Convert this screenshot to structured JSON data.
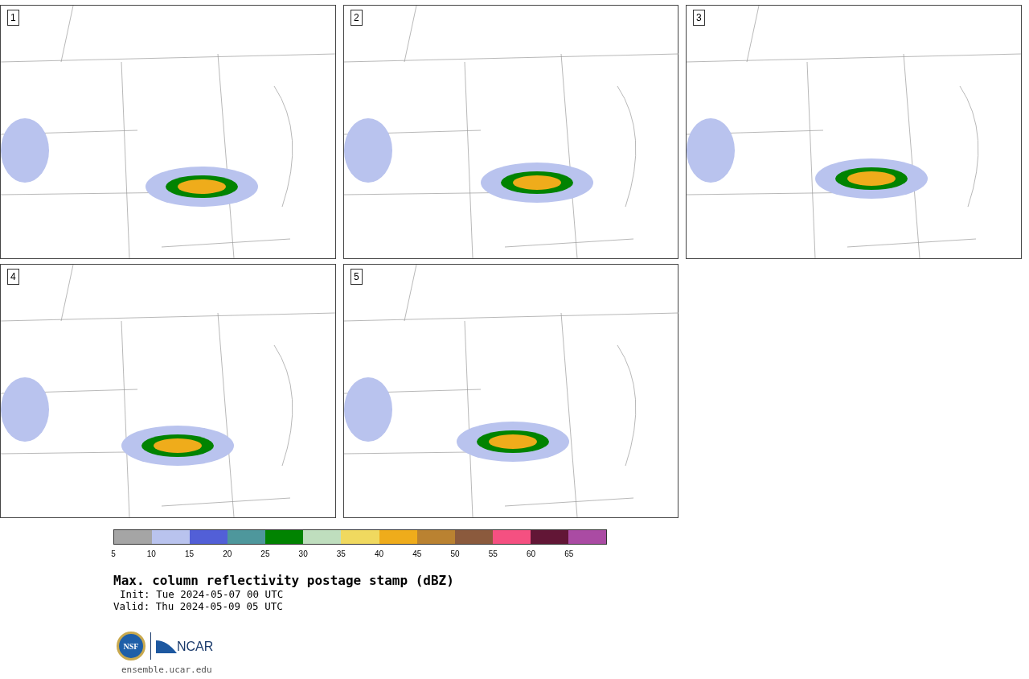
{
  "panels": [
    {
      "label": "1"
    },
    {
      "label": "2"
    },
    {
      "label": "3"
    },
    {
      "label": "4"
    },
    {
      "label": "5"
    }
  ],
  "colorbar": {
    "segments": [
      {
        "color": "#a5a5a5"
      },
      {
        "color": "#b9c3ee"
      },
      {
        "color": "#525fd7"
      },
      {
        "color": "#4e979c"
      },
      {
        "color": "#018301"
      },
      {
        "color": "#bfdebe"
      },
      {
        "color": "#f0d95f"
      },
      {
        "color": "#efac1b"
      },
      {
        "color": "#ba8231"
      },
      {
        "color": "#8b5a3d"
      },
      {
        "color": "#f55081"
      },
      {
        "color": "#621636"
      },
      {
        "color": "#aa4ba3"
      }
    ],
    "ticks": [
      "5",
      "10",
      "15",
      "20",
      "25",
      "30",
      "35",
      "40",
      "45",
      "50",
      "55",
      "60",
      "65"
    ]
  },
  "title": "Max. column reflectivity postage stamp (dBZ)",
  "init": "Init: Tue 2024-05-07 00 UTC",
  "valid": "Valid: Thu 2024-05-09 05 UTC",
  "logos": {
    "nsf": "NSF",
    "ncar": "NCAR"
  },
  "site": "ensemble.ucar.edu"
}
